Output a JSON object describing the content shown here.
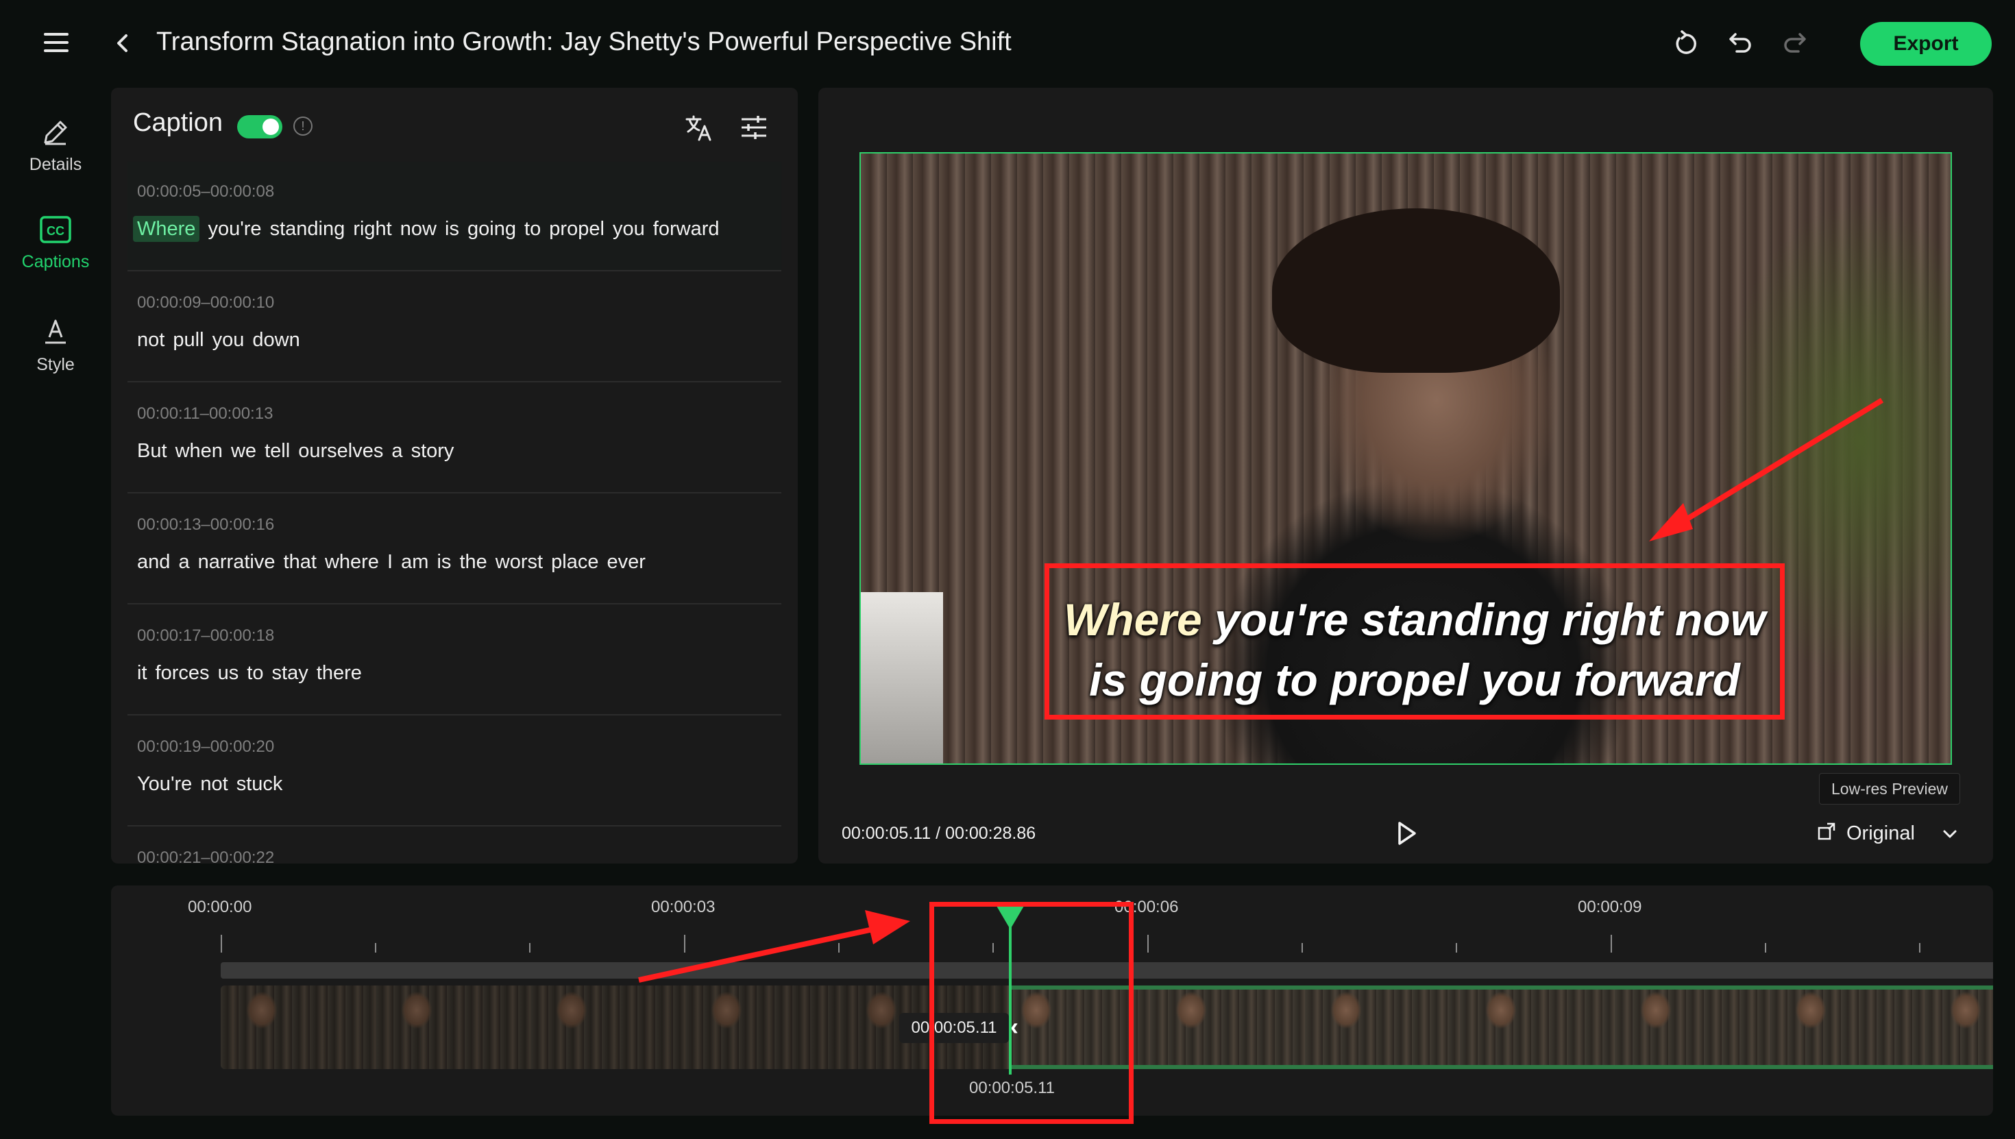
{
  "header": {
    "title": "Transform Stagnation into Growth: Jay Shetty's Powerful Perspective Shift",
    "export_label": "Export"
  },
  "sidebar": {
    "items": [
      {
        "label": "Details",
        "icon": "pencil-icon",
        "active": false
      },
      {
        "label": "Captions",
        "icon": "cc-icon",
        "active": true
      },
      {
        "label": "Style",
        "icon": "text-style-icon",
        "active": false
      }
    ]
  },
  "caption_panel": {
    "title": "Caption",
    "toggle_on": true,
    "captions": [
      {
        "time": "00:00:05–00:00:08",
        "highlight": "Where",
        "text": " you're standing right now is going to propel you forward",
        "active": true
      },
      {
        "time": "00:00:09–00:00:10",
        "highlight": "",
        "text": "not pull you down",
        "active": false
      },
      {
        "time": "00:00:11–00:00:13",
        "highlight": "",
        "text": "But when we tell ourselves a story",
        "active": false
      },
      {
        "time": "00:00:13–00:00:16",
        "highlight": "",
        "text": "and a narrative that where I am is the worst place ever",
        "active": false
      },
      {
        "time": "00:00:17–00:00:18",
        "highlight": "",
        "text": "it forces us to stay there",
        "active": false
      },
      {
        "time": "00:00:19–00:00:20",
        "highlight": "",
        "text": "You're not stuck",
        "active": false
      },
      {
        "time": "00:00:21–00:00:22",
        "highlight": "",
        "text": "",
        "active": false
      }
    ]
  },
  "preview": {
    "subtitle_line1_highlight": "Where",
    "subtitle_line1_rest": " you're standing right now",
    "subtitle_line2": "is going to propel you forward",
    "lowres_badge": "Low-res Preview",
    "current_time": "00:00:05.11",
    "time_separator": " / ",
    "duration": "00:00:28.86",
    "ratio_label": "Original"
  },
  "timeline": {
    "ticks": [
      "00:00:00",
      "00:00:03",
      "00:00:06",
      "00:00:09"
    ],
    "hover_time": "00:00:05.11",
    "playhead_time": "00:00:05.11"
  },
  "colors": {
    "accent": "#22d46e",
    "annotation_red": "#ff1e1e",
    "panel_bg": "#1a1a1a",
    "app_bg": "#0b0f0d"
  }
}
